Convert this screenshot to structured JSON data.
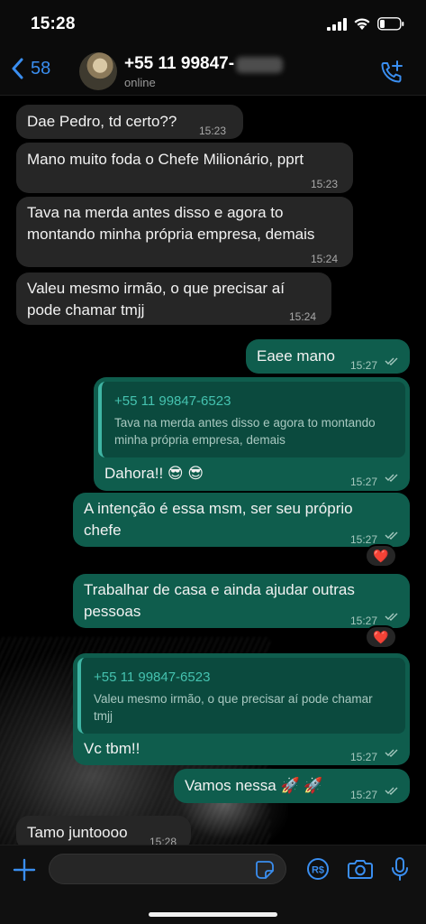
{
  "status_bar": {
    "time": "15:28"
  },
  "header": {
    "back_count": "58",
    "contact_name": "+55 11 99847-",
    "contact_status": "online"
  },
  "messages": [
    {
      "direction": "in",
      "text": "Dae Pedro, td certo??",
      "time": "15:23"
    },
    {
      "direction": "in",
      "text": "Mano muito foda o Chefe Milionário, pprt",
      "time": "15:23"
    },
    {
      "direction": "in",
      "text_lines": [
        "Tava na merda antes disso e agora to",
        "montando minha própria empresa, demais"
      ],
      "time": "15:24"
    },
    {
      "direction": "in",
      "text_lines": [
        "Valeu mesmo irmão, o que precisar aí",
        "pode chamar tmjj"
      ],
      "time": "15:24"
    },
    {
      "direction": "out",
      "text": "Eaee mano",
      "time": "15:27"
    },
    {
      "direction": "out",
      "quote": {
        "name": "+55 11 99847-6523",
        "text_lines": [
          "Tava na merda antes disso e agora to montando",
          "minha própria empresa, demais"
        ]
      },
      "text": "Dahora!! 😎 😎",
      "time": "15:27"
    },
    {
      "direction": "out",
      "text_lines": [
        "A intenção é essa msm, ser seu próprio",
        "chefe"
      ],
      "time": "15:27",
      "reaction": "❤️"
    },
    {
      "direction": "out",
      "text_lines": [
        "Trabalhar de casa e ainda ajudar outras",
        "pessoas"
      ],
      "time": "15:27",
      "reaction": "❤️"
    },
    {
      "direction": "out",
      "quote": {
        "name": "+55 11 99847-6523",
        "text_lines": [
          "Valeu mesmo irmão, o que precisar aí pode chamar",
          "tmjj"
        ]
      },
      "text": "Vc tbm!!",
      "time": "15:27"
    },
    {
      "direction": "out",
      "text": "Vamos  nessa 🚀 🚀",
      "time": "15:27"
    },
    {
      "direction": "in",
      "text": "Tamo juntoooo",
      "time": "15:28"
    }
  ],
  "input": {
    "placeholder": "",
    "value": ""
  },
  "colors": {
    "accent": "#3a8ef0",
    "outgoing_bubble": "#0f5d4d",
    "incoming_bubble": "#262626",
    "quote_name": "#45c3b0"
  }
}
